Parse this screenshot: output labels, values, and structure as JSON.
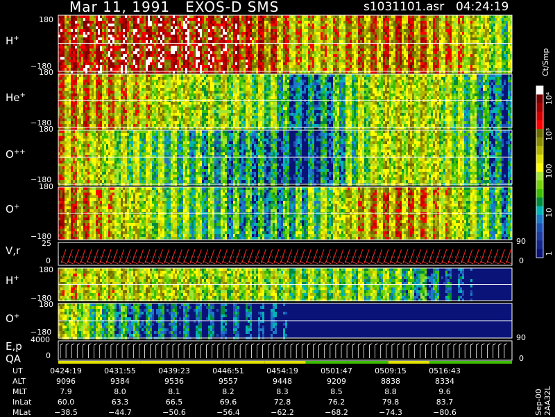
{
  "header": {
    "title": "Mar 11, 1991   EXOS-D SMS",
    "file": "s1031101.asr",
    "time": "04:24:19"
  },
  "panels": [
    {
      "label": "H",
      "sup": "+",
      "ymax": "180",
      "ymin": "−180",
      "species": "Hp"
    },
    {
      "label": "He",
      "sup": "+",
      "ymax": "180",
      "ymin": "−180",
      "species": "Hep"
    },
    {
      "label": "O",
      "sup": "++",
      "ymax": "180",
      "ymin": "−180",
      "species": "Opp"
    },
    {
      "label": "O",
      "sup": "+",
      "ymax": "180",
      "ymin": "−180",
      "species": "Op"
    }
  ],
  "vr_panel": {
    "label": "V,r",
    "left_top": "25",
    "left_bottom": "0",
    "right_top": "90",
    "right_bottom": "0"
  },
  "lower_panels": [
    {
      "label": "H",
      "sup": "+",
      "ymax": "180",
      "ymin": "−180"
    },
    {
      "label": "O",
      "sup": "+",
      "ymax": "180",
      "ymin": "−180",
      "right_bottom": "90"
    }
  ],
  "ep_panel": {
    "label1": "E,p",
    "label2": "QA",
    "left_top": "4000",
    "left_bottom": "0",
    "right_bottom": "0"
  },
  "colorbar": {
    "label": "Ct/Smp",
    "ticks": [
      "10⁴",
      "10³",
      "100",
      "10",
      "1"
    ],
    "colors": [
      "#ffffff",
      "#7a0000",
      "#a00000",
      "#d00000",
      "#ff0000",
      "#6e6e00",
      "#8c8c00",
      "#b4b400",
      "#e1e100",
      "#ffff00",
      "#a0e632",
      "#78d20a",
      "#3cbe00",
      "#008c3c",
      "#00b4b4",
      "#1e78c8",
      "#1e50b4",
      "#1e3ca0",
      "#14288c",
      "#0a1478"
    ]
  },
  "footer": {
    "rows": [
      {
        "name": "UT",
        "values": [
          "0424:19",
          "0431:55",
          "0439:23",
          "0446:51",
          "0454:19",
          "0501:47",
          "0509:15",
          "0516:43"
        ]
      },
      {
        "name": "ALT",
        "values": [
          "9096",
          "9384",
          "9536",
          "9557",
          "9448",
          "9209",
          "8838",
          "8334"
        ]
      },
      {
        "name": "MLT",
        "values": [
          "7.9",
          "8.0",
          "8.1",
          "8.2",
          "8.3",
          "8.5",
          "8.8",
          "9.6"
        ]
      },
      {
        "name": "InLat",
        "values": [
          "60.0",
          "63.3",
          "66.5",
          "69.6",
          "72.8",
          "76.2",
          "79.8",
          "83.7"
        ]
      },
      {
        "name": "MLat",
        "values": [
          "−38.5",
          "−44.7",
          "−50.6",
          "−56.4",
          "−62.2",
          "−68.2",
          "−74.3",
          "−80.6"
        ]
      }
    ],
    "stamp": "Sep-00  2AA32L"
  },
  "chart_data": {
    "type": "heatmap",
    "title": "Mar 11, 1991   EXOS-D SMS",
    "x": [
      "0424:19",
      "0431:55",
      "0439:23",
      "0446:51",
      "0454:19",
      "0501:47",
      "0509:15",
      "0516:43"
    ],
    "ylim": [
      -180,
      180
    ],
    "colorbar_label": "Ct/Smp",
    "colorbar_ticks": [
      "1",
      "10",
      "100",
      "10^3",
      "10^4"
    ],
    "series": [
      {
        "name": "H+",
        "intensity_profile": [
          3.2,
          3.3,
          3.3,
          3.4,
          3.4,
          3.3,
          3.2,
          3.0,
          2.4,
          2.5,
          2.8,
          2.9,
          2.9,
          2.6,
          2.2,
          1.5
        ]
      },
      {
        "name": "He+",
        "intensity_profile": [
          2.7,
          2.8,
          2.6,
          2.3,
          2.1,
          2.0,
          1.9,
          1.8,
          0.8,
          1.2,
          1.9,
          2.2,
          2.2,
          1.9,
          1.3,
          0.6
        ]
      },
      {
        "name": "O++",
        "intensity_profile": [
          2.6,
          2.3,
          1.9,
          1.7,
          1.5,
          1.3,
          1.2,
          1.0,
          0.6,
          1.0,
          1.8,
          2.2,
          2.2,
          1.9,
          1.3,
          0.6
        ]
      },
      {
        "name": "O+",
        "intensity_profile": [
          3.0,
          2.7,
          2.3,
          2.0,
          1.7,
          1.5,
          1.3,
          1.2,
          1.4,
          1.9,
          2.6,
          2.8,
          2.7,
          2.3,
          1.7,
          1.0
        ]
      },
      {
        "name": "H+ (lower)",
        "intensity_profile": [
          2.4,
          2.3,
          2.3,
          2.2,
          2.1,
          2.0,
          2.0,
          1.9,
          1.8,
          1.8,
          1.7,
          1.6,
          1.2,
          0.5,
          0.2,
          0.1
        ]
      },
      {
        "name": "O+ (lower)",
        "intensity_profile": [
          2.3,
          1.7,
          1.2,
          0.9,
          0.7,
          0.6,
          0.5,
          0.4,
          0.2,
          0.1,
          0.1,
          0.1,
          0.1,
          0.1,
          0.1,
          0.1
        ]
      }
    ]
  }
}
